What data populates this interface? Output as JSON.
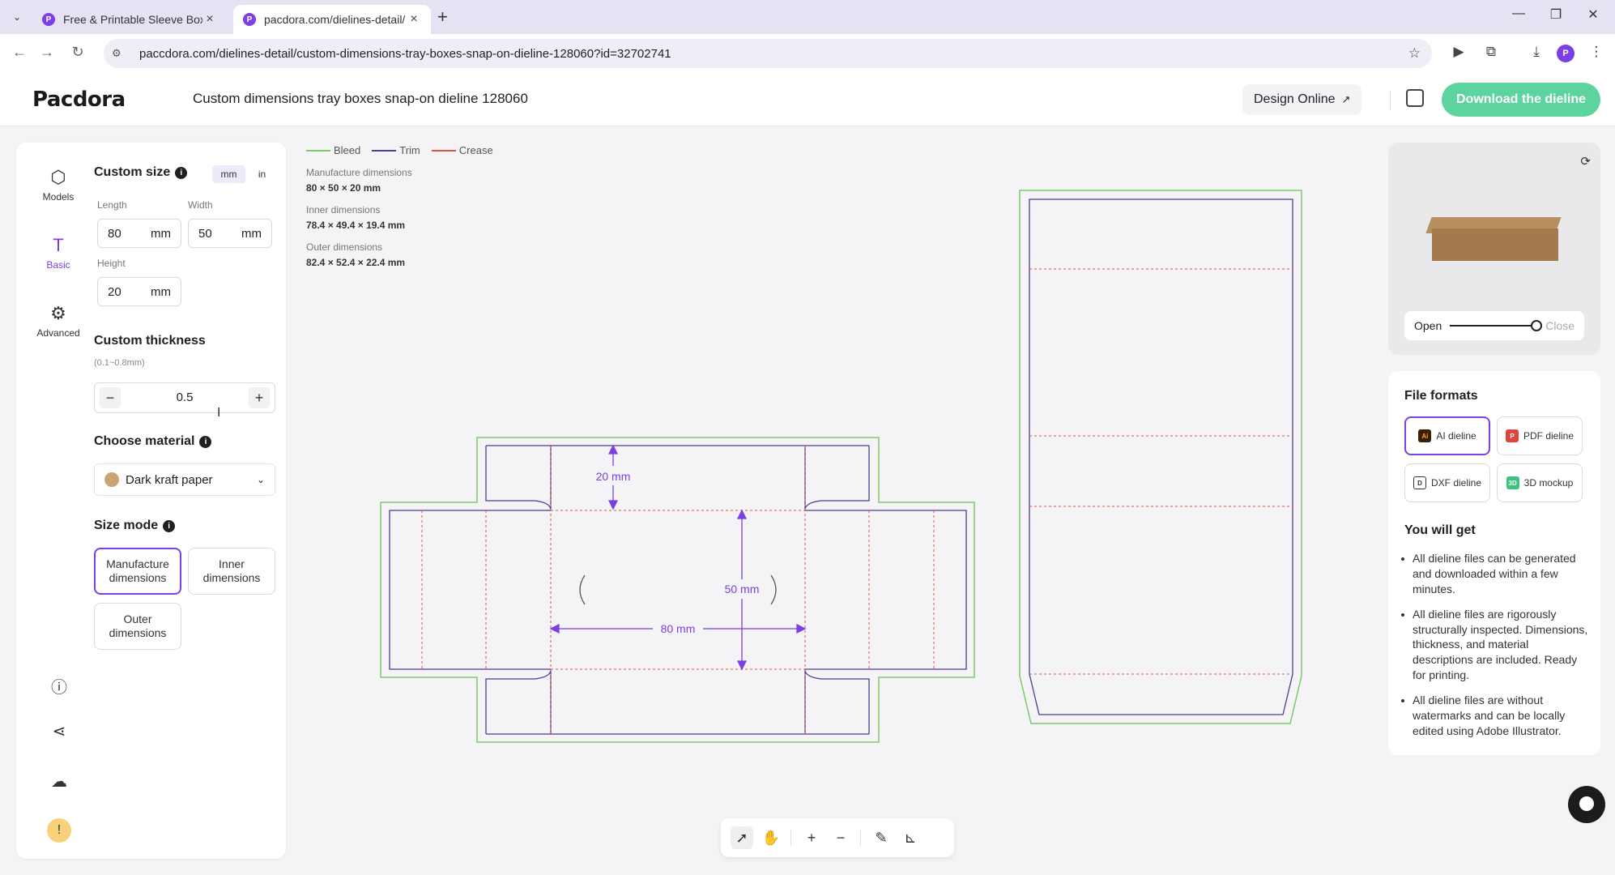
{
  "browser": {
    "tabs": [
      {
        "label": "Free & Printable Sleeve Box Te",
        "active": false
      },
      {
        "label": "pacdora.com/dielines-detail/",
        "active": true
      }
    ],
    "new_tab": "+",
    "url": "paccdora.com/dielines-detail/custom-dimensions-tray-boxes-snap-on-dieline-128060?id=32702741"
  },
  "header": {
    "logo": "Pacdora",
    "title": "Custom dimensions tray boxes snap-on dieline 128060",
    "design_online": "Design Online",
    "download": "Download the dieline"
  },
  "rail": {
    "models": "Models",
    "basic": "Basic",
    "advanced": "Advanced"
  },
  "custom_size": {
    "title": "Custom size",
    "units": [
      "mm",
      "in"
    ],
    "length_label": "Length",
    "length": "80",
    "width_label": "Width",
    "width": "50",
    "height_label": "Height",
    "height": "20",
    "unit": "mm"
  },
  "thickness": {
    "title": "Custom thickness",
    "hint": "(0.1~0.8mm)",
    "value": "0.5",
    "minus": "−",
    "plus": "+"
  },
  "material": {
    "title": "Choose material",
    "selected": "Dark kraft paper",
    "swatch": "#c9a574"
  },
  "size_mode": {
    "title": "Size mode",
    "manufacture": "Manufacture dimensions",
    "inner": "Inner dimensions",
    "outer": "Outer dimensions"
  },
  "legend": {
    "bleed": "Bleed",
    "trim": "Trim",
    "crease": "Crease",
    "colors": {
      "bleed": "#7cc96a",
      "trim": "#4b3f8f",
      "crease": "#d9534f"
    }
  },
  "dimensions": {
    "manufacture_label": "Manufacture dimensions",
    "manufacture": "80 × 50 × 20 mm",
    "inner_label": "Inner dimensions",
    "inner": "78.4 × 49.4 × 19.4 mm",
    "outer_label": "Outer dimensions",
    "outer": "82.4 × 52.4 × 22.4 mm"
  },
  "dieline": {
    "height_label": "20 mm",
    "width_label": "50 mm",
    "length_label": "80 mm",
    "dimension_color": "#7b3fe4"
  },
  "preview": {
    "open": "Open",
    "close": "Close",
    "level": 1.0
  },
  "file_formats": {
    "title": "File formats",
    "ai": "AI dieline",
    "pdf": "PDF dieline",
    "dxf": "DXF dieline",
    "mockup": "3D mockup"
  },
  "you_will_get": {
    "title": "You will get",
    "items": [
      "All dieline files can be generated and downloaded within a few minutes.",
      "All dieline files are rigorously structurally inspected. Dimensions, thickness, and material descriptions are included. Ready for printing.",
      "All dieline files are without watermarks and can be locally edited using Adobe Illustrator."
    ]
  },
  "accent_color": "#7b3fe4",
  "download_color": "#5dd39e"
}
